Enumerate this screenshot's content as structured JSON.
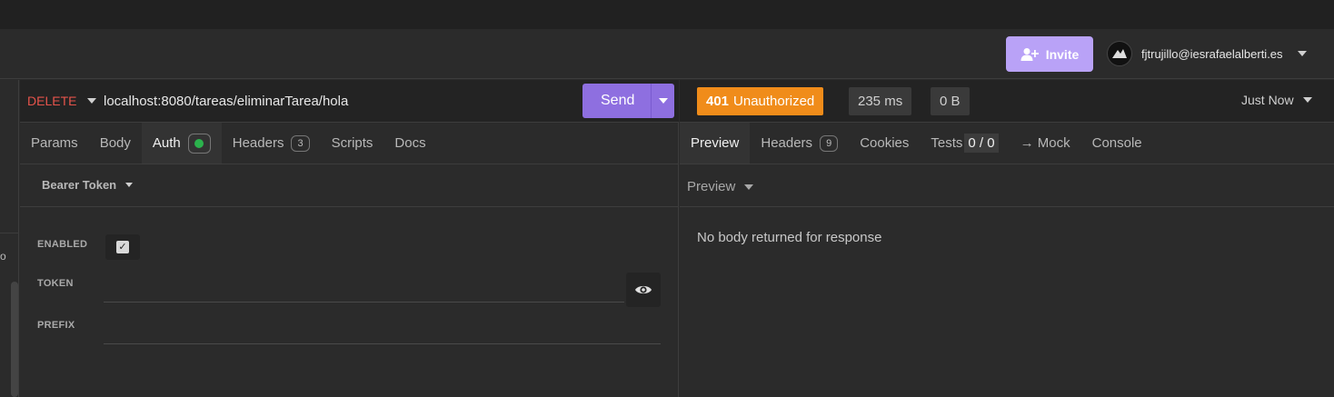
{
  "header": {
    "invite_label": "Invite",
    "user_email": "fjtrujillo@iesrafaelalberti.es"
  },
  "left_strip": {
    "fragment": "o"
  },
  "request": {
    "method": "DELETE",
    "url": "localhost:8080/tareas/eliminarTarea/hola",
    "send_label": "Send",
    "tabs": [
      {
        "label": "Params"
      },
      {
        "label": "Body"
      },
      {
        "label": "Auth"
      },
      {
        "label": "Headers",
        "badge": "3"
      },
      {
        "label": "Scripts"
      },
      {
        "label": "Docs"
      }
    ],
    "auth": {
      "type": "Bearer Token",
      "enabled_label": "ENABLED",
      "enabled": true,
      "token_label": "TOKEN",
      "token_value": "",
      "prefix_label": "PREFIX",
      "prefix_value": ""
    }
  },
  "response": {
    "status_code": "401",
    "status_text": "Unauthorized",
    "time": "235 ms",
    "size": "0 B",
    "history_label": "Just Now",
    "tabs": [
      {
        "label": "Preview"
      },
      {
        "label": "Headers",
        "badge": "9"
      },
      {
        "label": "Cookies"
      },
      {
        "label": "Tests",
        "badge": "0 / 0"
      },
      {
        "label": "→ Mock"
      },
      {
        "label": "Console"
      }
    ],
    "preview_mode": "Preview",
    "empty_message": "No body returned for response"
  },
  "colors": {
    "status_error": "#f08c1a",
    "accent": "#8e6fe0",
    "invite": "#b9a2f7",
    "method_delete": "#e5534b",
    "auth_active_dot": "#2bb24c"
  }
}
